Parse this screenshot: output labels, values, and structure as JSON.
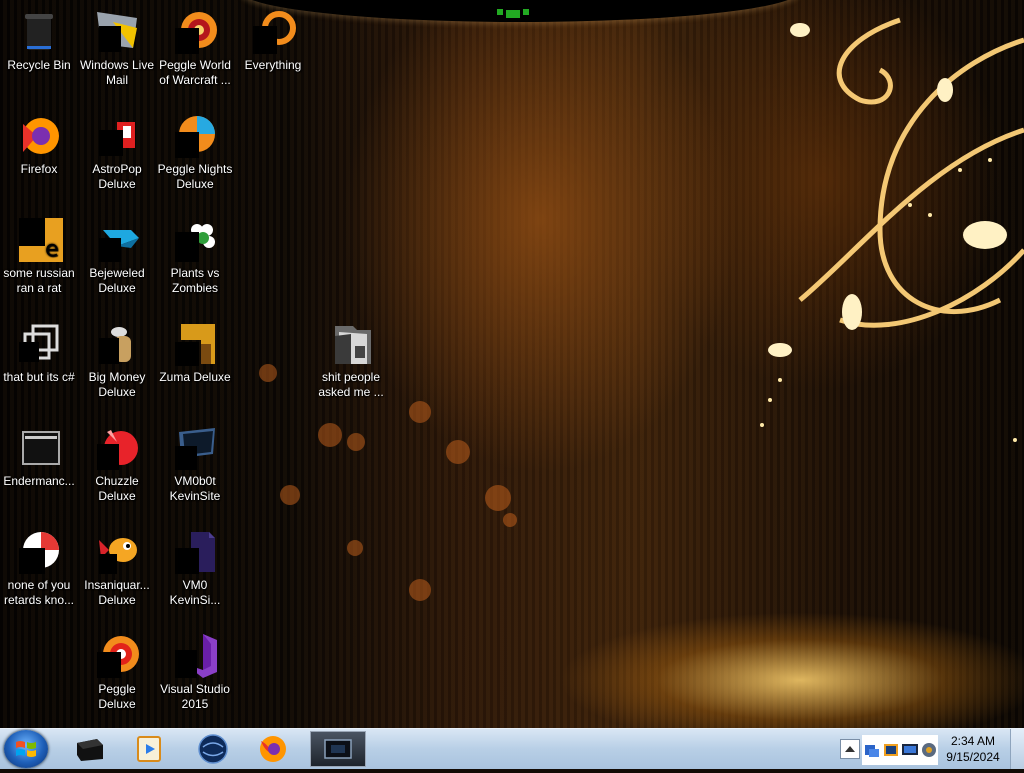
{
  "desktop": {
    "icons": [
      {
        "label": "Recycle Bin",
        "icon": "recycle-bin-icon"
      },
      {
        "label": "Windows Live\nMail",
        "icon": "mail-icon"
      },
      {
        "label": "Peggle World\nof Warcraft ...",
        "icon": "peggle-icon"
      },
      {
        "label": "Everything",
        "icon": "search-app-icon"
      },
      {
        "label": "Firefox",
        "icon": "firefox-icon"
      },
      {
        "label": "AstroPop\nDeluxe",
        "icon": "astropop-icon"
      },
      {
        "label": "Peggle Nights\nDeluxe",
        "icon": "peggle-icon"
      },
      {
        "label": "some russian\nran a rat",
        "icon": "app-icon"
      },
      {
        "label": "Bejeweled\nDeluxe",
        "icon": "gem-icon"
      },
      {
        "label": "Plants vs\nZombies",
        "icon": "plant-icon"
      },
      {
        "label": "that but its c#",
        "icon": "shortcut-icon"
      },
      {
        "label": "Big Money\nDeluxe",
        "icon": "money-icon"
      },
      {
        "label": "Zuma Deluxe",
        "icon": "zuma-icon"
      },
      {
        "label": "shit people\nasked me ...",
        "icon": "folder-icon"
      },
      {
        "label": "Endermanc...",
        "icon": "window-icon"
      },
      {
        "label": "Chuzzle\nDeluxe",
        "icon": "chuzzle-icon"
      },
      {
        "label": "VM0b0t\nKevinSite",
        "icon": "vm-icon"
      },
      {
        "label": "none of you\nretards kno...",
        "icon": "app-icon"
      },
      {
        "label": "Insaniquar...\nDeluxe",
        "icon": "fish-icon"
      },
      {
        "label": "VM0\nKevinSi...",
        "icon": "file-icon"
      },
      {
        "label": "Peggle Deluxe",
        "icon": "peggle-icon"
      },
      {
        "label": "Visual Studio\n2015",
        "icon": "visual-studio-icon"
      }
    ]
  },
  "taskbar": {
    "pinned": [
      {
        "name": "explorer-window",
        "icon": "black-box-icon"
      },
      {
        "name": "media-player",
        "icon": "media-player-icon"
      },
      {
        "name": "globe-app",
        "icon": "globe-icon"
      },
      {
        "name": "firefox",
        "icon": "firefox-icon"
      },
      {
        "name": "active-window",
        "icon": "window-icon"
      }
    ],
    "clock": {
      "time": "2:34 AM",
      "date": "9/15/2024"
    }
  },
  "colors": {
    "taskbar": "#b8cfe6",
    "wallpaper_glow": "#ffcc66",
    "accent_green": "#22aa22"
  }
}
